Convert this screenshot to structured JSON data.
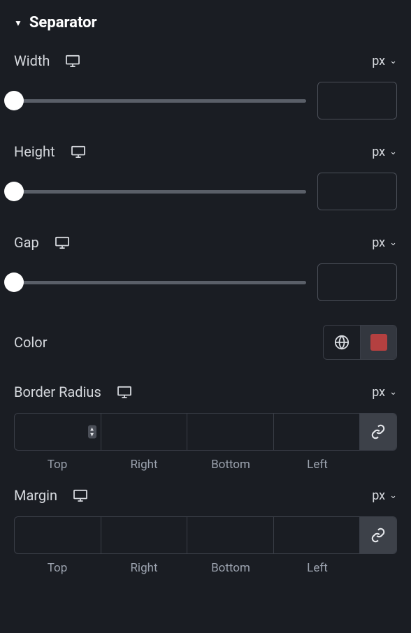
{
  "section": {
    "title": "Separator"
  },
  "width": {
    "label": "Width",
    "unit": "px",
    "value": ""
  },
  "height": {
    "label": "Height",
    "unit": "px",
    "value": ""
  },
  "gap": {
    "label": "Gap",
    "unit": "px",
    "value": ""
  },
  "color": {
    "label": "Color",
    "swatch": "#b44040"
  },
  "borderRadius": {
    "label": "Border Radius",
    "unit": "px",
    "top": "",
    "right": "",
    "bottom": "",
    "left": "",
    "sideLabels": {
      "top": "Top",
      "right": "Right",
      "bottom": "Bottom",
      "left": "Left"
    }
  },
  "margin": {
    "label": "Margin",
    "unit": "px",
    "top": "",
    "right": "",
    "bottom": "",
    "left": "",
    "sideLabels": {
      "top": "Top",
      "right": "Right",
      "bottom": "Bottom",
      "left": "Left"
    }
  }
}
